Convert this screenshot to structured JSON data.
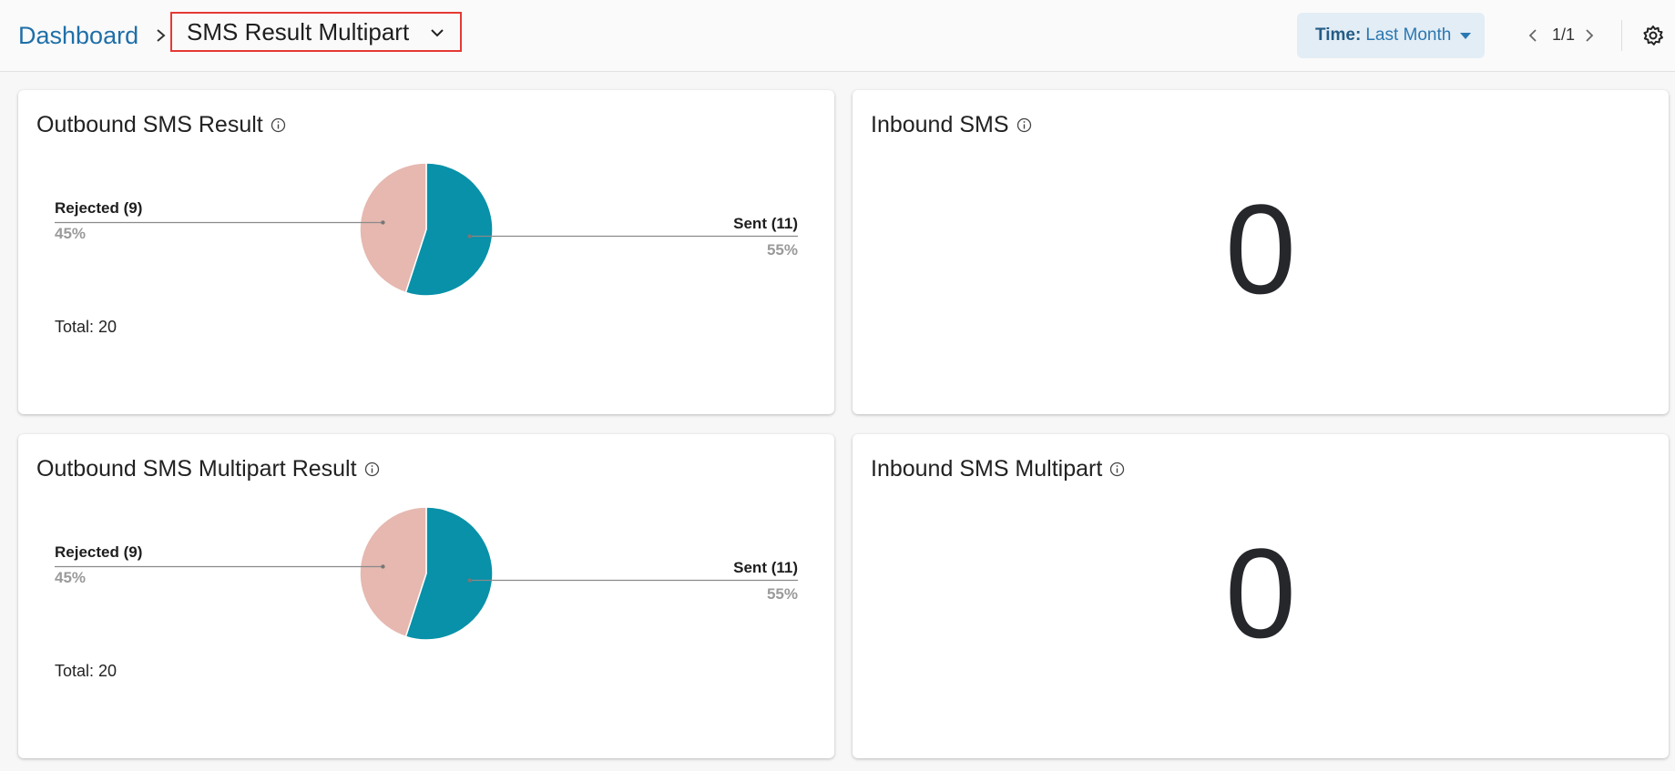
{
  "header": {
    "breadcrumb_root": "Dashboard",
    "current_dashboard": "SMS Result Multipart",
    "time_label": "Time:",
    "time_value": "Last Month",
    "pager": "1/1"
  },
  "cards": {
    "outbound_result": {
      "title": "Outbound SMS Result",
      "total": "Total: 20",
      "chart_data": {
        "type": "pie",
        "categories": [
          "Rejected (9)",
          "Sent (11)"
        ],
        "values": [
          9,
          11
        ],
        "percent_labels": [
          "45%",
          "55%"
        ],
        "colors": [
          "#e6b8b0",
          "#0891a8"
        ]
      }
    },
    "inbound": {
      "title": "Inbound SMS",
      "value": "0"
    },
    "outbound_multipart": {
      "title": "Outbound SMS Multipart Result",
      "total": "Total: 20",
      "chart_data": {
        "type": "pie",
        "categories": [
          "Rejected (9)",
          "Sent (11)"
        ],
        "values": [
          9,
          11
        ],
        "percent_labels": [
          "45%",
          "55%"
        ],
        "colors": [
          "#e6b8b0",
          "#0891a8"
        ]
      }
    },
    "inbound_multipart": {
      "title": "Inbound SMS Multipart",
      "value": "0"
    }
  },
  "colors": {
    "accent": "#1f6fa8",
    "highlight_border": "#e53935",
    "time_button_bg": "#e3edf5"
  }
}
